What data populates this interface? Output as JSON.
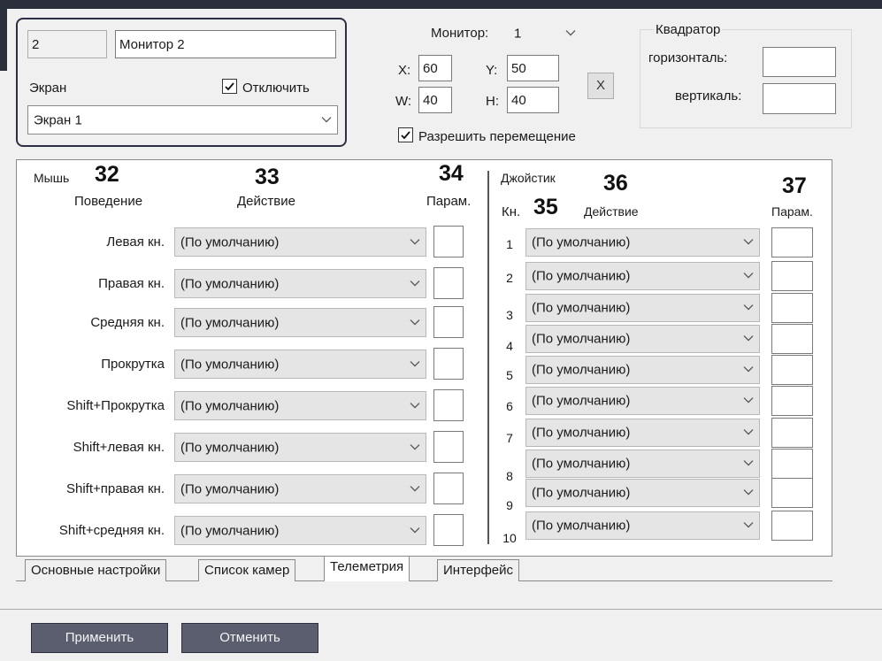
{
  "monitor": {
    "id": "2",
    "name": "Монитор 2",
    "screen_label": "Экран",
    "disable_label": "Отключить",
    "disable_checked": true,
    "screen_value": "Экран 1"
  },
  "position": {
    "monitor_label": "Монитор:",
    "monitor_value": "1",
    "x_label": "X:",
    "x_value": "60",
    "y_label": "Y:",
    "y_value": "50",
    "w_label": "W:",
    "w_value": "40",
    "h_label": "H:",
    "h_value": "40",
    "close_glyph": "X",
    "allow_move_label": "Разрешить перемещение",
    "allow_move_checked": true
  },
  "quadrator": {
    "title": "Квадратор",
    "horizontal_label": "горизонталь:",
    "horizontal_value": "",
    "vertical_label": "вертикаль:",
    "vertical_value": ""
  },
  "mouse": {
    "title": "Мышь",
    "behavior_header": "Поведение",
    "action_header": "Действие",
    "param_header": "Парам.",
    "rows": [
      {
        "label": "Левая кн.",
        "action": "(По умолчанию)",
        "param": ""
      },
      {
        "label": "Правая кн.",
        "action": "(По умолчанию)",
        "param": ""
      },
      {
        "label": "Средняя кн.",
        "action": "(По умолчанию)",
        "param": ""
      },
      {
        "label": "Прокрутка",
        "action": "(По умолчанию)",
        "param": ""
      },
      {
        "label": "Shift+Прокрутка",
        "action": "(По умолчанию)",
        "param": ""
      },
      {
        "label": "Shift+левая кн.",
        "action": "(По умолчанию)",
        "param": ""
      },
      {
        "label": "Shift+правая кн.",
        "action": "(По умолчанию)",
        "param": ""
      },
      {
        "label": "Shift+средняя кн.",
        "action": "(По умолчанию)",
        "param": ""
      }
    ]
  },
  "joystick": {
    "title": "Джойстик",
    "button_header": "Кн.",
    "action_header": "Действие",
    "param_header": "Парам.",
    "rows": [
      {
        "num": "1",
        "action": "(По умолчанию)"
      },
      {
        "num": "2",
        "action": "(По умолчанию)"
      },
      {
        "num": "3",
        "action": "(По умолчанию)"
      },
      {
        "num": "4",
        "action": "(По умолчанию)"
      },
      {
        "num": "5",
        "action": "(По умолчанию)"
      },
      {
        "num": "6",
        "action": "(По умолчанию)"
      },
      {
        "num": "7",
        "action": "(По умолчанию)"
      },
      {
        "num": "8",
        "action": "(По умолчанию)"
      },
      {
        "num": "9",
        "action": "(По умолчанию)"
      },
      {
        "num": "10",
        "action": "(По умолчанию)"
      }
    ]
  },
  "callouts": {
    "c32": "32",
    "c33": "33",
    "c34": "34",
    "c35": "35",
    "c36": "36",
    "c37": "37"
  },
  "tabs": [
    {
      "label": "Основные настройки",
      "active": false
    },
    {
      "label": "Список камер",
      "active": false
    },
    {
      "label": "Телеметрия",
      "active": true
    },
    {
      "label": "Интерфейс",
      "active": false
    }
  ],
  "footer": {
    "apply_label": "Применить",
    "cancel_label": "Отменить"
  },
  "icons": {
    "dropdown": "chevron-down-icon",
    "checkbox": "checkmark-icon"
  }
}
